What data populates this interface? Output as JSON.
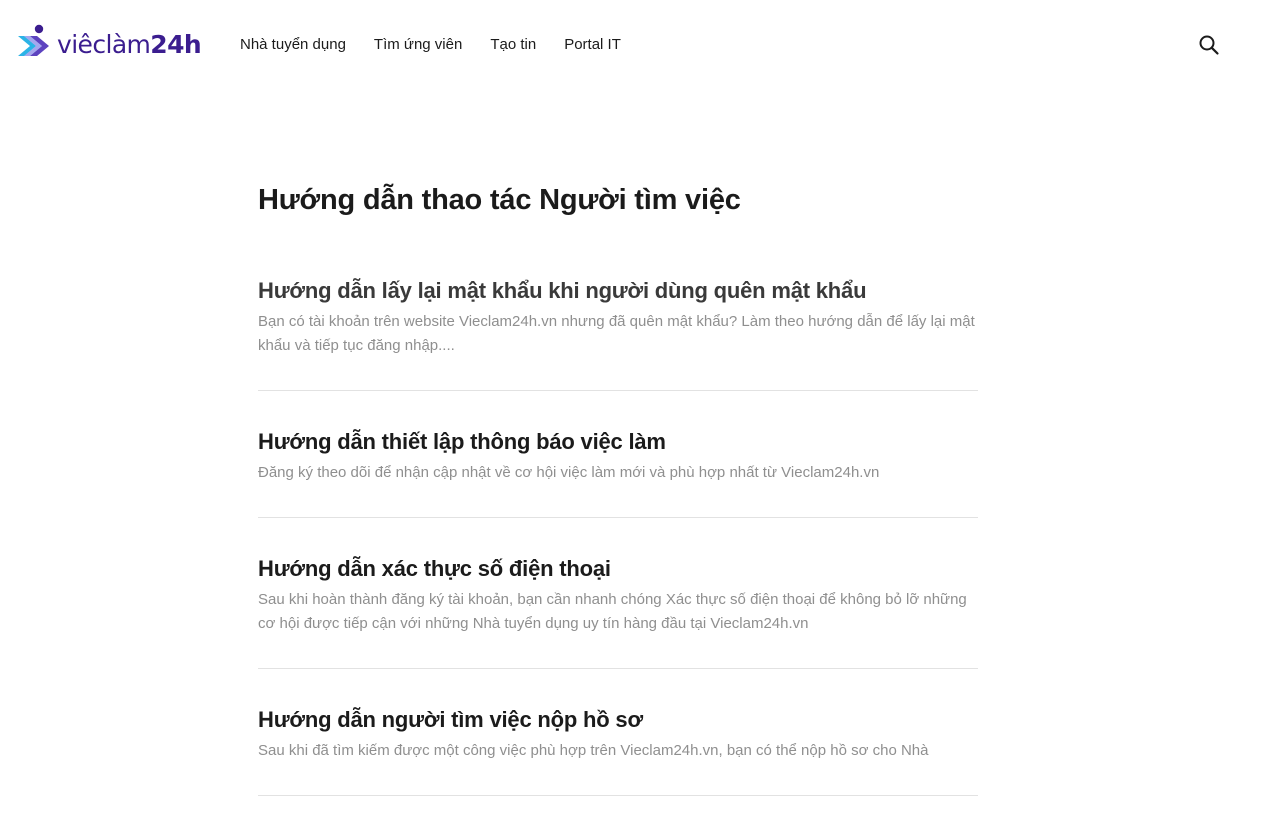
{
  "header": {
    "logo": {
      "text_prefix": "viêclàm",
      "text_suffix": "24h",
      "brand_color": "#3b1d8f",
      "accent_color": "#2bb3e6",
      "icon": "vieclam24h-logo-mark"
    },
    "nav": [
      {
        "label": "Nhà tuyển dụng"
      },
      {
        "label": "Tìm ứng viên"
      },
      {
        "label": "Tạo tin"
      },
      {
        "label": "Portal IT"
      }
    ],
    "search_icon": "search-icon"
  },
  "main": {
    "title": "Hướng dẫn thao tác Người tìm việc",
    "articles": [
      {
        "title": "Hướng dẫn lấy lại mật khẩu khi người dùng quên mật khẩu",
        "description": "Bạn có tài khoản trên website Vieclam24h.vn nhưng đã quên mật khẩu? Làm theo hướng dẫn để lấy lại mật khẩu và tiếp tục đăng nhập...."
      },
      {
        "title": "Hướng dẫn thiết lập thông báo việc làm",
        "description": "Đăng ký theo dõi để nhận cập nhật về cơ hội việc làm mới và phù hợp nhất từ Vieclam24h.vn"
      },
      {
        "title": "Hướng dẫn xác thực số điện thoại",
        "description": "Sau khi hoàn thành đăng ký tài khoản, bạn cần nhanh chóng Xác thực số điện thoại để không bỏ lỡ những cơ hội được tiếp cận với những Nhà tuyển dụng uy tín hàng đầu tại Vieclam24h.vn"
      },
      {
        "title": "Hướng dẫn người tìm việc nộp hồ sơ",
        "description": "Sau khi đã tìm kiếm được một công việc phù hợp trên Vieclam24h.vn, bạn có thể nộp hồ sơ cho Nhà"
      }
    ]
  }
}
